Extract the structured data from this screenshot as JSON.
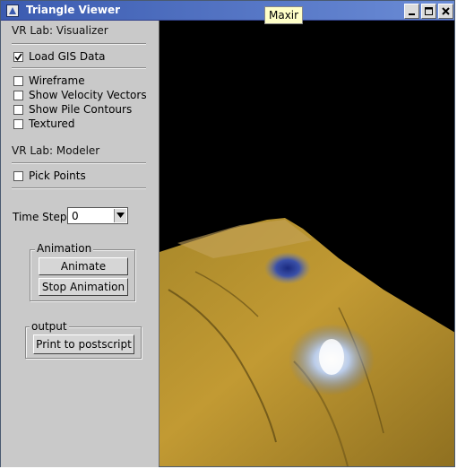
{
  "window": {
    "title": "Triangle Viewer"
  },
  "visualizer": {
    "heading": "VR Lab: Visualizer",
    "checkboxes": [
      {
        "label": "Load GIS Data",
        "checked": true
      },
      {
        "label": "Wireframe",
        "checked": false
      },
      {
        "label": "Show Velocity Vectors",
        "checked": false
      },
      {
        "label": "Show Pile Contours",
        "checked": false
      },
      {
        "label": "Textured",
        "checked": false
      }
    ]
  },
  "modeler": {
    "heading": "VR Lab: Modeler",
    "checkboxes": [
      {
        "label": "Pick Points",
        "checked": false
      }
    ]
  },
  "time_step": {
    "label": "Time Step:",
    "value": "0"
  },
  "animation": {
    "title": "Animation",
    "animate_label": "Animate",
    "stop_label": "Stop Animation"
  },
  "output": {
    "title": "output",
    "print_label": "Print to postscript"
  },
  "tooltip": {
    "text": "Maxir"
  },
  "colors": {
    "titlebar": "#3b5bb0",
    "panel": "#c9c9c9",
    "terrain": "#b8952a",
    "snow": "#cfe4ff"
  }
}
